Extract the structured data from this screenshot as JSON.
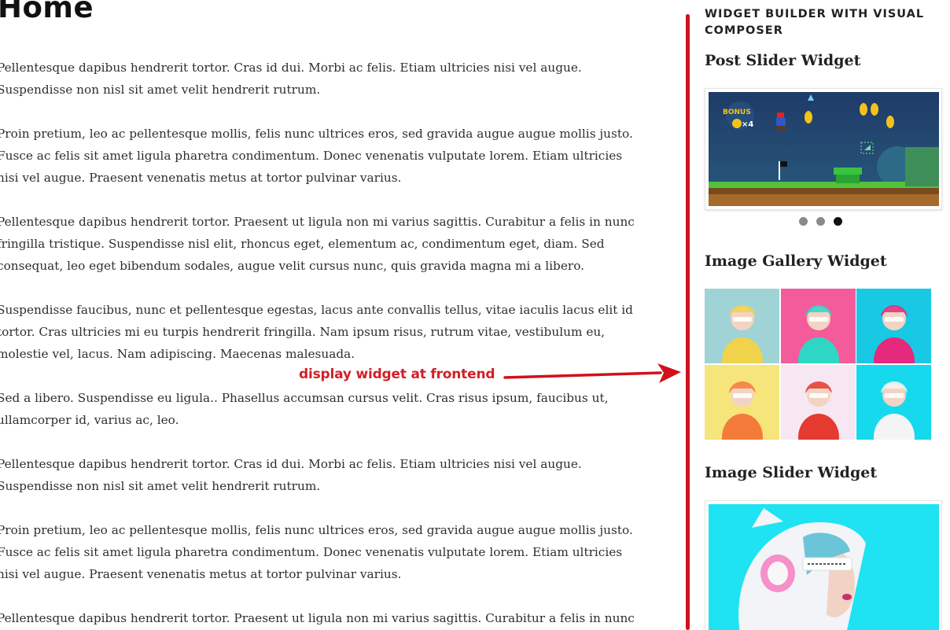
{
  "page": {
    "title": "Home",
    "paragraphs": [
      [
        "Pellentesque dapibus hendrerit tortor. Cras id dui. Morbi ac felis. Etiam ultricies nisi vel augue.",
        "Suspendisse non nisl sit amet velit hendrerit rutrum."
      ],
      [
        "Proin pretium, leo ac pellentesque mollis, felis nunc ultrices eros, sed gravida augue augue mollis justo.",
        "Fusce ac felis sit amet ligula pharetra condimentum. Donec venenatis vulputate lorem. Etiam ultricies",
        "nisi vel augue. Praesent venenatis metus at tortor pulvinar varius."
      ],
      [
        "Pellentesque dapibus hendrerit tortor. Praesent ut ligula non mi varius sagittis. Curabitur a felis in nunc",
        "fringilla tristique. Suspendisse nisl elit, rhoncus eget, elementum ac, condimentum eget, diam. Sed",
        "consequat, leo eget bibendum sodales, augue velit cursus nunc, quis gravida magna mi a libero."
      ],
      [
        "Suspendisse faucibus, nunc et pellentesque egestas, lacus ante convallis tellus, vitae iaculis lacus elit id",
        "tortor. Cras ultricies mi eu turpis hendrerit fringilla. Nam ipsum risus, rutrum vitae, vestibulum eu,",
        "molestie vel, lacus. Nam adipiscing. Maecenas malesuada."
      ],
      [
        "Sed a libero. Suspendisse eu ligula.. Phasellus accumsan cursus velit. Cras risus ipsum, faucibus ut,",
        "ullamcorper id, varius ac, leo."
      ],
      [
        "Pellentesque dapibus hendrerit tortor. Cras id dui. Morbi ac felis. Etiam ultricies nisi vel augue.",
        "Suspendisse non nisl sit amet velit hendrerit rutrum."
      ],
      [
        "Proin pretium, leo ac pellentesque mollis, felis nunc ultrices eros, sed gravida augue augue mollis justo.",
        "Fusce ac felis sit amet ligula pharetra condimentum. Donec venenatis vulputate lorem. Etiam ultricies",
        "nisi vel augue. Praesent venenatis metus at tortor pulvinar varius."
      ],
      [
        "Pellentesque dapibus hendrerit tortor. Praesent ut ligula non mi varius sagittis. Curabitur a felis in nunc"
      ]
    ]
  },
  "annotation": {
    "label": "display widget at frontend",
    "color": "#d21f26"
  },
  "sidebar": {
    "title": "WIDGET BUILDER WITH VISUAL COMPOSER",
    "post_slider": {
      "title": "Post Slider Widget",
      "slide_count": 3,
      "active_slide": 3,
      "image_icon": "platformer-game-icon",
      "bonus_text": "BONUS",
      "multiplier_text": "×4"
    },
    "image_gallery": {
      "title": "Image Gallery Widget",
      "items": [
        {
          "name": "gallery-image-1",
          "bg": "#9fd3d6",
          "accent": "#f0d34a"
        },
        {
          "name": "gallery-image-2",
          "bg": "#f45b9a",
          "accent": "#2fd6c6"
        },
        {
          "name": "gallery-image-3",
          "bg": "#19c9e4",
          "accent": "#e42a7c"
        },
        {
          "name": "gallery-image-4",
          "bg": "#f6e57a",
          "accent": "#f57b3a"
        },
        {
          "name": "gallery-image-5",
          "bg": "#f6e7f2",
          "accent": "#e53a2f"
        },
        {
          "name": "gallery-image-6",
          "bg": "#16d9ee",
          "accent": "#f4f4f4"
        }
      ]
    },
    "image_slider": {
      "title": "Image Slider Widget",
      "bg": "#1fe3f2"
    }
  }
}
